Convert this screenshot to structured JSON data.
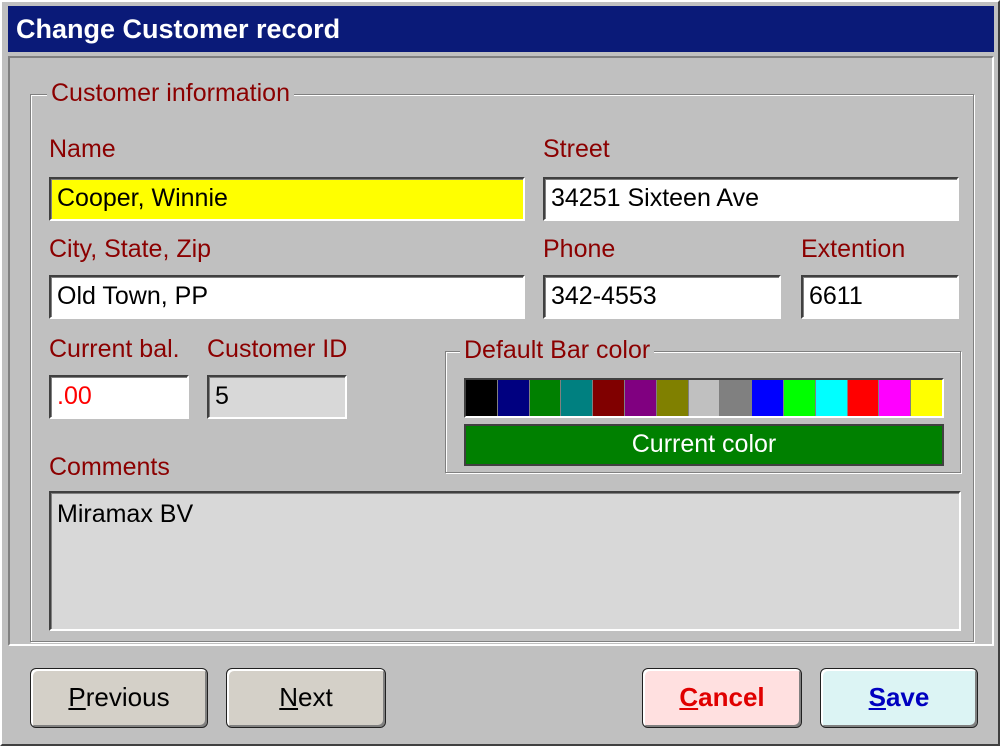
{
  "window": {
    "title": "Change Customer record"
  },
  "customer_info": {
    "legend": "Customer information",
    "name": {
      "label": "Name",
      "value": "Cooper, Winnie"
    },
    "street": {
      "label": "Street",
      "value": "34251 Sixteen Ave"
    },
    "city": {
      "label": "City, State,  Zip",
      "value": "Old Town, PP"
    },
    "phone": {
      "label": "Phone",
      "value": "342-4553"
    },
    "extension": {
      "label": "Extention",
      "value": "6611"
    },
    "balance": {
      "label": "Current bal.",
      "value": ".00"
    },
    "customer_id": {
      "label": "Customer ID",
      "value": "5"
    },
    "comments": {
      "label": "Comments",
      "value": "Miramax BV"
    }
  },
  "bar_color": {
    "legend": "Default Bar color",
    "palette": [
      "#000000",
      "#000080",
      "#008000",
      "#008080",
      "#800000",
      "#800080",
      "#808000",
      "#c0c0c0",
      "#808080",
      "#0000ff",
      "#00ff00",
      "#00ffff",
      "#ff0000",
      "#ff00ff",
      "#ffff00"
    ],
    "current_label": "Current color",
    "current_value": "#008000"
  },
  "buttons": {
    "previous": {
      "accel": "P",
      "rest": "revious"
    },
    "next": {
      "accel": "N",
      "rest": "ext"
    },
    "cancel": {
      "accel": "C",
      "rest": "ancel"
    },
    "save": {
      "accel": "S",
      "rest": "ave"
    }
  }
}
